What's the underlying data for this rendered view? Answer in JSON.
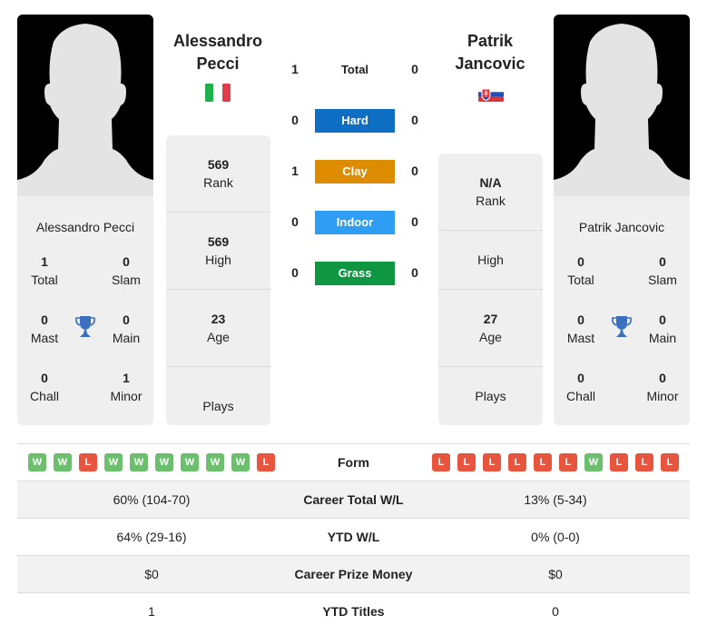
{
  "colors": {
    "hard": "#0d6ec4",
    "clay": "#dd8c00",
    "indoor": "#2e9ef5",
    "grass": "#0e9640",
    "win": "#6cbf6c",
    "loss": "#e8553e",
    "trophy": "#3b6fbf"
  },
  "player1": {
    "name_line1": "Alessandro",
    "name_line2": "Pecci",
    "full_name": "Alessandro Pecci",
    "flag": "italy-flag",
    "titles": {
      "total": {
        "value": "1",
        "label": "Total"
      },
      "slam": {
        "value": "0",
        "label": "Slam"
      },
      "mast": {
        "value": "0",
        "label": "Mast"
      },
      "main": {
        "value": "0",
        "label": "Main"
      },
      "chall": {
        "value": "0",
        "label": "Chall"
      },
      "minor": {
        "value": "1",
        "label": "Minor"
      }
    },
    "stats": {
      "rank": {
        "value": "569",
        "label": "Rank"
      },
      "high": {
        "value": "569",
        "label": "High"
      },
      "age": {
        "value": "23",
        "label": "Age"
      },
      "plays": {
        "value": "",
        "label": "Plays"
      }
    },
    "form": [
      "W",
      "W",
      "L",
      "W",
      "W",
      "W",
      "W",
      "W",
      "W",
      "L"
    ]
  },
  "player2": {
    "name_line1": "Patrik",
    "name_line2": "Jancovic",
    "full_name": "Patrik Jancovic",
    "flag": "slovakia-flag",
    "titles": {
      "total": {
        "value": "0",
        "label": "Total"
      },
      "slam": {
        "value": "0",
        "label": "Slam"
      },
      "mast": {
        "value": "0",
        "label": "Mast"
      },
      "main": {
        "value": "0",
        "label": "Main"
      },
      "chall": {
        "value": "0",
        "label": "Chall"
      },
      "minor": {
        "value": "0",
        "label": "Minor"
      }
    },
    "stats": {
      "rank": {
        "value": "N/A",
        "label": "Rank"
      },
      "high": {
        "value": "",
        "label": "High"
      },
      "age": {
        "value": "27",
        "label": "Age"
      },
      "plays": {
        "value": "",
        "label": "Plays"
      }
    },
    "form": [
      "L",
      "L",
      "L",
      "L",
      "L",
      "L",
      "W",
      "L",
      "L",
      "L"
    ]
  },
  "h2h": [
    {
      "label": "Total",
      "p1": "1",
      "p2": "0",
      "surface": "total"
    },
    {
      "label": "Hard",
      "p1": "0",
      "p2": "0",
      "surface": "hard"
    },
    {
      "label": "Clay",
      "p1": "1",
      "p2": "0",
      "surface": "clay"
    },
    {
      "label": "Indoor",
      "p1": "0",
      "p2": "0",
      "surface": "indoor"
    },
    {
      "label": "Grass",
      "p1": "0",
      "p2": "0",
      "surface": "grass"
    }
  ],
  "comparison": {
    "form_label": "Form",
    "rows": [
      {
        "label": "Career Total W/L",
        "p1": "60% (104-70)",
        "p2": "13% (5-34)"
      },
      {
        "label": "YTD W/L",
        "p1": "64% (29-16)",
        "p2": "0% (0-0)"
      },
      {
        "label": "Career Prize Money",
        "p1": "$0",
        "p2": "$0"
      },
      {
        "label": "YTD Titles",
        "p1": "1",
        "p2": "0"
      }
    ]
  }
}
